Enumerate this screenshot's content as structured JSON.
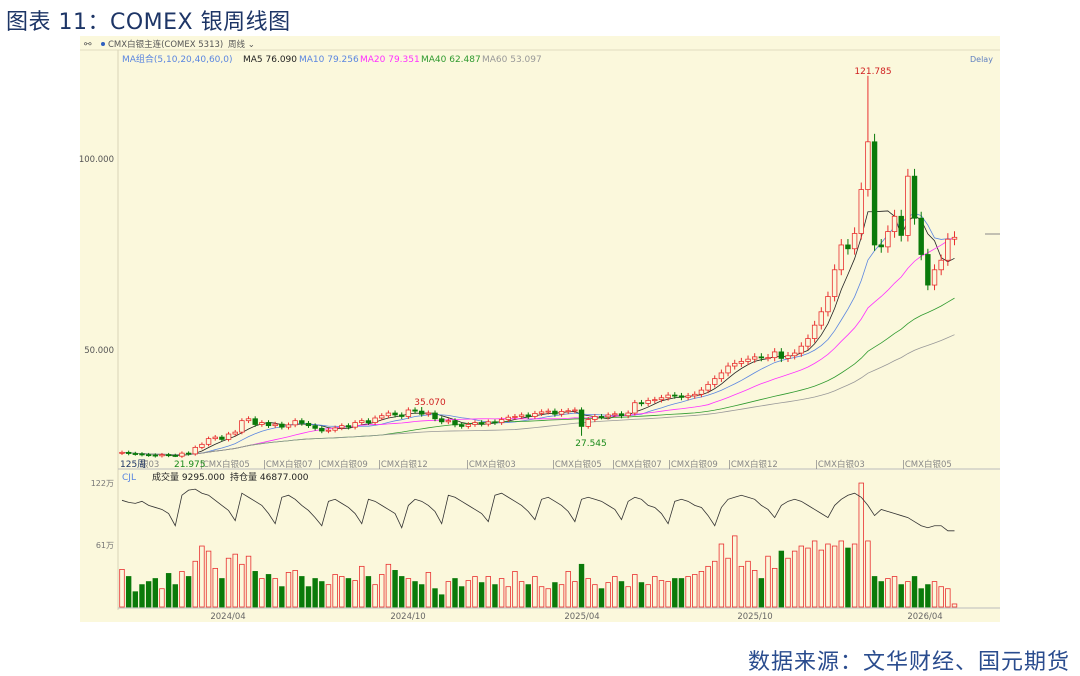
{
  "title": "图表 11：COMEX 银周线图",
  "source": "数据来源：文华财经、国元期货",
  "header": {
    "instrument": "CMX白银主连(COMEX 5313)",
    "period": "周线",
    "delay": "Delay"
  },
  "ma_legend": {
    "group": "MA组合(5,10,20,40,60,0)",
    "ma5": "MA5 76.090",
    "ma10": "MA10 79.256",
    "ma20": "MA20 79.351",
    "ma40": "MA40 62.487",
    "ma60": "MA60 53.097"
  },
  "vol_legend": {
    "name": "CJL",
    "volume": "成交量 9295.000",
    "oi": "持仓量 46877.000"
  },
  "colors": {
    "up": "#e83030",
    "down": "#0a7a0a",
    "panel_bg": "#fbf8dc",
    "ma5": "#222222",
    "ma10": "#5b86e0",
    "ma20": "#ff30ff",
    "ma40": "#2f9a2f",
    "ma60": "#999999"
  },
  "chart_data": {
    "type": "candlestick",
    "period_count_label": "125周",
    "price_ticks": [
      "100.000",
      "50.000"
    ],
    "volume_ticks": [
      "122万",
      "61万"
    ],
    "x_ticks": [
      "2024/04",
      "2024/10",
      "2025/04",
      "2025/10",
      "2026/04"
    ],
    "contract_labels": [
      "银03",
      "CMX白银05",
      "CMX白银07",
      "CMX白银09",
      "CMX白银12",
      "CMX白银03",
      "CMX白银05",
      "CMX白银07",
      "CMX白银09",
      "CMX白银12",
      "CMX白银03",
      "CMX白银05"
    ],
    "annotations": {
      "high": "121.785",
      "peak_2024": "35.070",
      "low_2025": "27.545",
      "low_2024": "21.975"
    },
    "close": [
      23.2,
      22.9,
      22.8,
      22.6,
      22.5,
      22.3,
      22.6,
      22.4,
      22.2,
      23.0,
      22.8,
      24.5,
      25.3,
      26.8,
      27.2,
      26.6,
      28.0,
      28.5,
      31.5,
      32.0,
      30.5,
      31.0,
      30.2,
      30.6,
      29.8,
      30.4,
      31.5,
      30.8,
      30.2,
      29.5,
      28.8,
      29.0,
      29.6,
      30.2,
      29.8,
      31.0,
      31.5,
      31.0,
      32.2,
      32.8,
      33.5,
      33.0,
      32.6,
      34.3,
      34.0,
      33.2,
      33.5,
      32.0,
      31.2,
      31.5,
      30.4,
      30.0,
      30.5,
      31.0,
      30.6,
      31.2,
      31.0,
      31.8,
      32.4,
      32.6,
      33.0,
      32.6,
      33.4,
      33.8,
      34.0,
      33.2,
      33.9,
      34.1,
      34.3,
      30.0,
      31.8,
      32.6,
      32.5,
      33.0,
      33.3,
      32.8,
      33.5,
      36.2,
      36.0,
      36.8,
      37.0,
      37.5,
      38.2,
      38.0,
      37.6,
      38.0,
      38.4,
      39.5,
      41.0,
      42.5,
      44.0,
      45.8,
      46.5,
      47.0,
      47.6,
      48.2,
      48.0,
      48.0,
      49.5,
      47.8,
      48.5,
      49.2,
      51.0,
      53.0,
      56.5,
      60.0,
      64.0,
      71.0,
      77.5,
      76.5,
      80.5,
      92.0,
      104.5,
      77.5,
      77.0,
      81.0,
      85.0,
      80.0,
      95.5,
      84.5,
      75.0,
      67.0,
      71.0,
      73.5,
      79.0,
      79.5
    ],
    "volume_wan": [
      37,
      30,
      15,
      22,
      25,
      28,
      18,
      33,
      22,
      35,
      30,
      45,
      60,
      55,
      38,
      28,
      48,
      52,
      42,
      50,
      35,
      28,
      32,
      28,
      20,
      34,
      36,
      30,
      20,
      28,
      25,
      22,
      32,
      30,
      28,
      26,
      40,
      30,
      22,
      32,
      42,
      36,
      30,
      28,
      25,
      22,
      34,
      18,
      12,
      25,
      28,
      20,
      26,
      30,
      24,
      30,
      22,
      28,
      20,
      35,
      25,
      22,
      30,
      20,
      18,
      24,
      22,
      35,
      25,
      42,
      28,
      22,
      18,
      24,
      30,
      25,
      20,
      32,
      24,
      22,
      30,
      26,
      25,
      28,
      28,
      30,
      32,
      35,
      40,
      45,
      62,
      48,
      70,
      40,
      45,
      36,
      28,
      50,
      38,
      55,
      48,
      55,
      60,
      58,
      65,
      56,
      62,
      60,
      65,
      58,
      62,
      122,
      65,
      30,
      25,
      28,
      30,
      22,
      25,
      30,
      18,
      22,
      25,
      20,
      18,
      3
    ],
    "open_interest_wan": [
      105,
      103,
      102,
      104,
      100,
      98,
      96,
      92,
      80,
      110,
      115,
      116,
      112,
      110,
      105,
      100,
      95,
      85,
      112,
      108,
      104,
      100,
      92,
      82,
      108,
      110,
      106,
      100,
      95,
      88,
      80,
      104,
      106,
      102,
      98,
      92,
      82,
      106,
      104,
      100,
      96,
      92,
      78,
      100,
      106,
      104,
      100,
      94,
      82,
      110,
      108,
      104,
      100,
      96,
      92,
      84,
      110,
      112,
      108,
      104,
      100,
      94,
      86,
      106,
      108,
      104,
      100,
      94,
      84,
      106,
      108,
      106,
      104,
      100,
      96,
      86,
      104,
      108,
      106,
      100,
      98,
      92,
      82,
      104,
      106,
      104,
      100,
      98,
      90,
      80,
      98,
      106,
      108,
      110,
      108,
      106,
      100,
      96,
      88,
      100,
      104,
      106,
      104,
      100,
      96,
      92,
      88,
      100,
      106,
      110,
      112,
      108,
      100,
      90,
      96,
      94,
      92,
      90,
      88,
      84,
      80,
      78,
      80,
      80,
      75,
      75
    ],
    "high_override": {
      "112": 121.785,
      "45": 35.07,
      "8": 21.975,
      "69": 27.545
    }
  }
}
